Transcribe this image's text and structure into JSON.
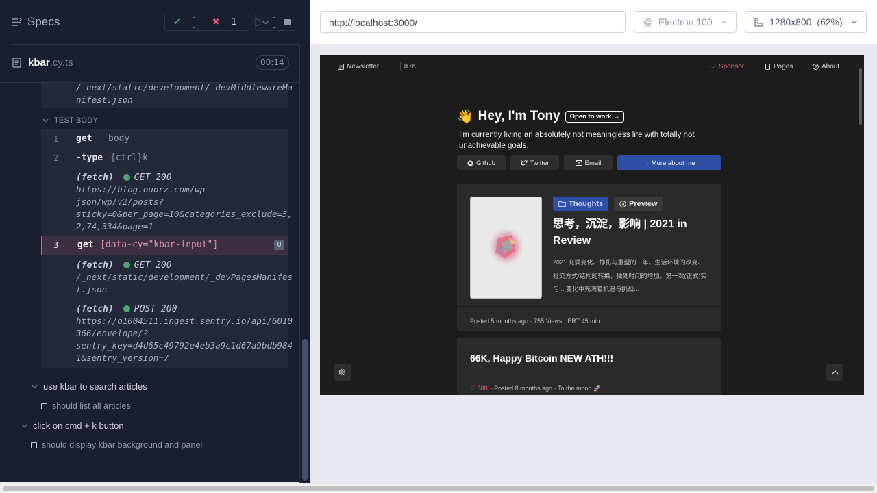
{
  "reporter": {
    "title": "Specs",
    "stats": {
      "passed": "--",
      "failed": "1",
      "pending": "--"
    },
    "spec": {
      "name": "kbar",
      "ext": ".cy.ts",
      "duration": "00:14"
    },
    "prev_url": [
      "/_next/static/development/_devMiddlewareMa",
      "nifest.json"
    ],
    "test_body_label": "TEST BODY",
    "commands": {
      "c1": {
        "num": "1",
        "name": "get",
        "arg": "body"
      },
      "c2": {
        "num": "2",
        "name": "-type",
        "arg": "{ctrl}k"
      },
      "f1": {
        "label": "(fetch)",
        "method": "GET 200",
        "url": [
          "https://blog.ouorz.com/wp-",
          "json/wp/v2/posts?",
          "sticky=0&per_page=10&categories_exclude=5,",
          "2,74,334&page=1"
        ]
      },
      "c3": {
        "num": "3",
        "name": "get",
        "arg": "[data-cy=\"kbar-input\"]",
        "badge": "0"
      },
      "f2": {
        "label": "(fetch)",
        "method": "GET 200",
        "url": [
          "/_next/static/development/_devPagesManifes",
          "t.json"
        ]
      },
      "f3": {
        "label": "(fetch)",
        "method": "POST 200",
        "url": [
          "https://o1004511.ingest.sentry.io/api/6010",
          "366/envelope/?",
          "sentry_key=d4d65c49792e4eb3a9c1d67a9bdb984",
          "1&sentry_version=7"
        ]
      }
    },
    "suites": {
      "s1": {
        "title": "use kbar to search articles",
        "test": "should list all articles"
      },
      "s2": {
        "title": "click on cmd + k button",
        "test": "should display kbar background and panel"
      }
    }
  },
  "browser": {
    "url": "http://localhost:3000/",
    "engine": "Electron 100",
    "viewport": "1280x800  (62%)"
  },
  "site": {
    "nav": {
      "newsletter": "Newsletter",
      "shortcut": "⌘+K",
      "sponsor": "Sponsor",
      "pages": "Pages",
      "about": "About"
    },
    "hero": {
      "wave": "👋",
      "title": "Hey, I'm Tony",
      "badge": "Open to work →",
      "subtitle": "I'm currently living an absolutely not meaningless life with totally not unachievable goals."
    },
    "buttons": {
      "github": "Github",
      "twitter": "Twitter",
      "email": "Email",
      "more": "→ More about me"
    },
    "post1": {
      "tag": "Thoughts",
      "preview": "Preview",
      "title": "思考，沉淀，影响 | 2021 in Review",
      "desc": "2021 充满变化、挣扎与重塑的一年。生活环境的改变、社交方式/结构的转换、独处时间的增加、第一次(正式)实习... 变化中充满着机遇与挑战...",
      "meta": "Posted 5 months ago · 755 Views · ERT 45 min"
    },
    "post2": {
      "title": "66K, Happy Bitcoin NEW ATH!!!",
      "likes": "300",
      "meta": "· Posted 8 months ago · To the moon 🚀"
    }
  }
}
